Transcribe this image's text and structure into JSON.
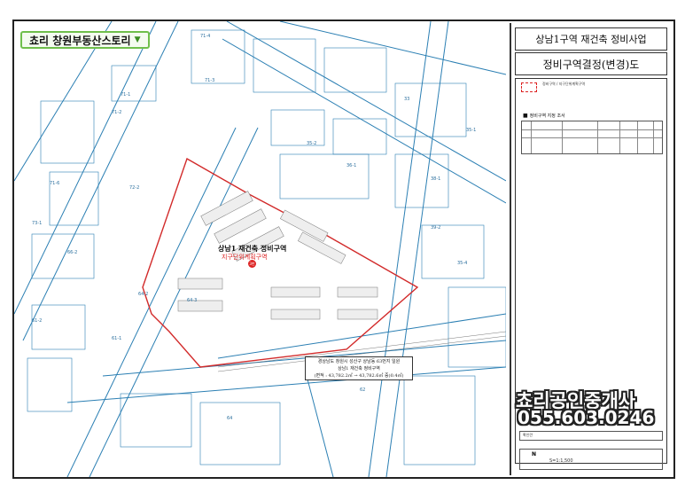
{
  "badge": {
    "text": "쵸리 창원부동산스토리",
    "arrow": "▼"
  },
  "panel": {
    "title_project": "상남1구역 재건축 정비사업",
    "title_decision": "정비구역결정(변경)도",
    "legend_label": "정비구역 / 지구단위계획구역",
    "section_title": "정비구역 지정 조서",
    "confirm_label": "확인란",
    "scale_text": "S=1:1,500",
    "north_label": "N"
  },
  "zone": {
    "title": "상남1 재건축 정비구역",
    "subtitle": "지구단위계획구역",
    "marker": "3번"
  },
  "callout": {
    "line1": "경상남도 창원시 성산구 상남동 63번지 일원",
    "line2": "상남1 재건축 정비구역",
    "line3": "(면적 : 43,782.2㎡ → 43,782.6㎡ 증)0.4㎡)"
  },
  "promo": {
    "line1": "쵸리공인중개사",
    "line2": "055.603.0246"
  },
  "parcel_labels": [
    "71-4",
    "71-3",
    "71-1",
    "71-2",
    "71-6",
    "72-2",
    "73-1",
    "66-2",
    "64-2",
    "64-3",
    "61-2",
    "61-1",
    "33",
    "35-1",
    "35-2",
    "36-1",
    "38-1",
    "39-2",
    "35-4",
    "62",
    "64"
  ],
  "colors": {
    "road_line": "#2b7fb3",
    "boundary": "#d22a2a",
    "frame": "#222222"
  }
}
